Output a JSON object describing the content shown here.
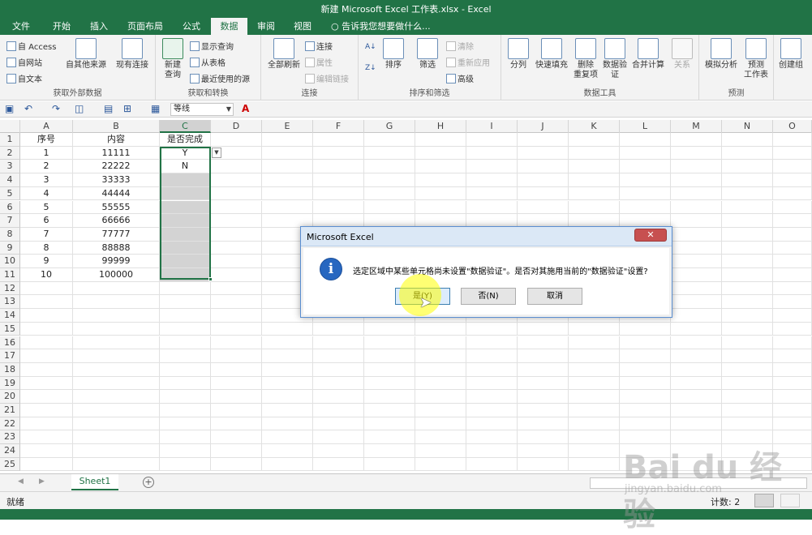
{
  "window": {
    "title": "新建 Microsoft Excel 工作表.xlsx - Excel"
  },
  "tabs": [
    {
      "label": "文件",
      "active": false
    },
    {
      "label": "开始",
      "active": false
    },
    {
      "label": "插入",
      "active": false
    },
    {
      "label": "页面布局",
      "active": false
    },
    {
      "label": "公式",
      "active": false
    },
    {
      "label": "数据",
      "active": true
    },
    {
      "label": "审阅",
      "active": false
    },
    {
      "label": "视图",
      "active": false
    }
  ],
  "tell_me": "告诉我您想要做什么...",
  "ribbon": {
    "get_external": {
      "label": "获取外部数据",
      "access": "自 Access",
      "web": "自网站",
      "text": "自文本",
      "other": "自其他来源",
      "existing": "现有连接"
    },
    "transform": {
      "label": "获取和转换",
      "new_query_1": "新建",
      "new_query_2": "查询",
      "show_queries": "显示查询",
      "from_table": "从表格",
      "recent": "最近使用的源"
    },
    "connections": {
      "label": "连接",
      "refresh_all": "全部刷新",
      "connections": "连接",
      "properties": "属性",
      "edit_links": "编辑链接"
    },
    "sort_filter": {
      "label": "排序和筛选",
      "sort": "排序",
      "filter": "筛选",
      "clear": "清除",
      "reapply": "重新应用",
      "advanced": "高级"
    },
    "data_tools": {
      "label": "数据工具",
      "text_to_columns": "分列",
      "flash_fill": "快速填充",
      "remove_dup_1": "删除",
      "remove_dup_2": "重复项",
      "validation_1": "数据验",
      "validation_2": "证",
      "consolidate": "合并计算",
      "relationships": "关系"
    },
    "forecast": {
      "label": "预测",
      "what_if": "模拟分析",
      "forecast_sheet_1": "预测",
      "forecast_sheet_2": "工作表"
    },
    "outline": {
      "group": "创建组"
    }
  },
  "qat": {
    "font_name": "等线"
  },
  "columns": [
    "A",
    "B",
    "C",
    "D",
    "E",
    "F",
    "G",
    "H",
    "I",
    "J",
    "K",
    "L",
    "M",
    "N",
    "O"
  ],
  "rows": [
    {
      "n": "1",
      "a": "序号",
      "b": "内容",
      "c": "是否完成"
    },
    {
      "n": "2",
      "a": "1",
      "b": "11111",
      "c": "Y"
    },
    {
      "n": "3",
      "a": "2",
      "b": "22222",
      "c": "N"
    },
    {
      "n": "4",
      "a": "3",
      "b": "33333",
      "c": ""
    },
    {
      "n": "5",
      "a": "4",
      "b": "44444",
      "c": ""
    },
    {
      "n": "6",
      "a": "5",
      "b": "55555",
      "c": ""
    },
    {
      "n": "7",
      "a": "6",
      "b": "66666",
      "c": ""
    },
    {
      "n": "8",
      "a": "7",
      "b": "77777",
      "c": ""
    },
    {
      "n": "9",
      "a": "8",
      "b": "88888",
      "c": ""
    },
    {
      "n": "10",
      "a": "9",
      "b": "99999",
      "c": ""
    },
    {
      "n": "11",
      "a": "10",
      "b": "100000",
      "c": ""
    },
    {
      "n": "12",
      "a": "",
      "b": "",
      "c": ""
    },
    {
      "n": "13",
      "a": "",
      "b": "",
      "c": ""
    },
    {
      "n": "14",
      "a": "",
      "b": "",
      "c": ""
    },
    {
      "n": "15",
      "a": "",
      "b": "",
      "c": ""
    },
    {
      "n": "16",
      "a": "",
      "b": "",
      "c": ""
    },
    {
      "n": "17",
      "a": "",
      "b": "",
      "c": ""
    },
    {
      "n": "18",
      "a": "",
      "b": "",
      "c": ""
    },
    {
      "n": "19",
      "a": "",
      "b": "",
      "c": ""
    },
    {
      "n": "20",
      "a": "",
      "b": "",
      "c": ""
    },
    {
      "n": "21",
      "a": "",
      "b": "",
      "c": ""
    },
    {
      "n": "22",
      "a": "",
      "b": "",
      "c": ""
    },
    {
      "n": "23",
      "a": "",
      "b": "",
      "c": ""
    },
    {
      "n": "24",
      "a": "",
      "b": "",
      "c": ""
    },
    {
      "n": "25",
      "a": "",
      "b": "",
      "c": ""
    }
  ],
  "sheet_tab": "Sheet1",
  "status": {
    "mode": "就绪",
    "count": "计数: 2"
  },
  "dialog": {
    "title": "Microsoft Excel",
    "close": "✕",
    "message": "选定区域中某些单元格尚未设置\"数据验证\"。是否对其施用当前的\"数据验证\"设置?",
    "yes": "是(Y)",
    "no": "否(N)",
    "cancel": "取消"
  },
  "watermark": {
    "main": "Bai du 经验",
    "sub": "jingyan.baidu.com"
  },
  "colors": {
    "accent": "#217346",
    "selection_fill": "#d3d3d3",
    "dialog_border": "#5a8ed1"
  }
}
